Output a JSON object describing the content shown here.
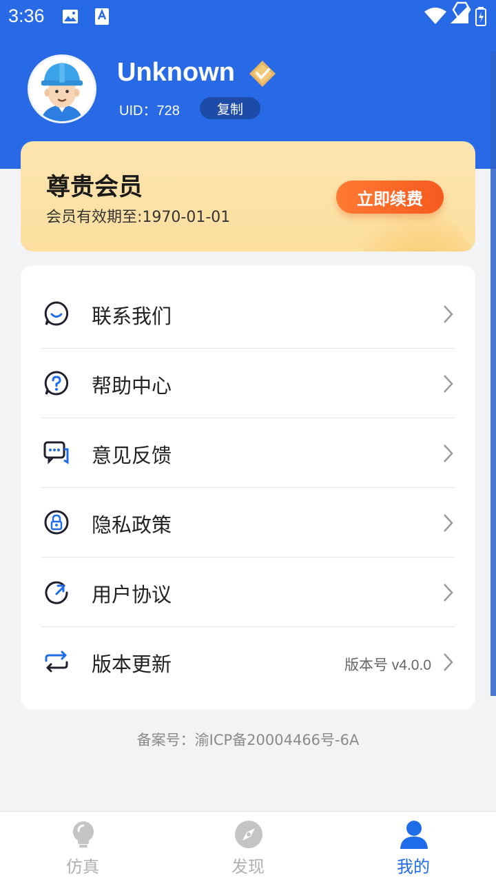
{
  "status_bar": {
    "time": "3:36"
  },
  "profile": {
    "username": "Unknown",
    "uid_label": "UID：728",
    "copy_label": "复制"
  },
  "member": {
    "title": "尊贵会员",
    "expiry": "会员有效期至:1970-01-01",
    "renew_label": "立即续费"
  },
  "menu": {
    "items": [
      {
        "label": "联系我们",
        "icon": "chat-smile-icon"
      },
      {
        "label": "帮助中心",
        "icon": "help-circle-icon"
      },
      {
        "label": "意见反馈",
        "icon": "feedback-icon"
      },
      {
        "label": "隐私政策",
        "icon": "privacy-lock-icon"
      },
      {
        "label": "用户协议",
        "icon": "user-agreement-icon"
      },
      {
        "label": "版本更新",
        "icon": "refresh-icon",
        "value": "版本号 v4.0.0"
      }
    ]
  },
  "footer": {
    "icp": "备案号：渝ICP备20004466号-6A"
  },
  "bottom_nav": {
    "items": [
      {
        "label": "仿真",
        "icon": "lightbulb-icon",
        "active": false
      },
      {
        "label": "发现",
        "icon": "compass-icon",
        "active": false
      },
      {
        "label": "我的",
        "icon": "person-icon",
        "active": true
      }
    ]
  },
  "colors": {
    "primary": "#2869e6",
    "renew_button": "#f65a1f",
    "member_card": "#fde5b0",
    "nav_active": "#1f6ce8",
    "nav_inactive": "#b0b0b0"
  }
}
